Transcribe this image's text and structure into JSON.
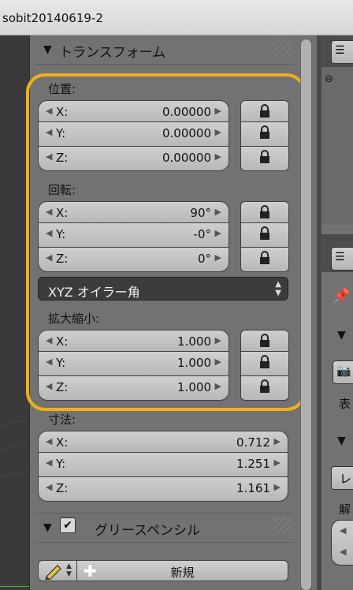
{
  "window": {
    "title": "sobit20140619-2"
  },
  "transform": {
    "header": "トランスフォーム",
    "location": {
      "label": "位置:",
      "rows": [
        {
          "axis": "X:",
          "value": "0.00000"
        },
        {
          "axis": "Y:",
          "value": "0.00000"
        },
        {
          "axis": "Z:",
          "value": "0.00000"
        }
      ]
    },
    "rotation": {
      "label": "回転:",
      "rows": [
        {
          "axis": "X:",
          "value": "90°"
        },
        {
          "axis": "Y:",
          "value": "-0°"
        },
        {
          "axis": "Z:",
          "value": "0°"
        }
      ]
    },
    "rotation_mode": "XYZ オイラー角",
    "scale": {
      "label": "拡大縮小:",
      "rows": [
        {
          "axis": "X:",
          "value": "1.000"
        },
        {
          "axis": "Y:",
          "value": "1.000"
        },
        {
          "axis": "Z:",
          "value": "1.000"
        }
      ]
    },
    "dimensions": {
      "label": "寸法:",
      "rows": [
        {
          "axis": "X:",
          "value": "0.712"
        },
        {
          "axis": "Y:",
          "value": "1.251"
        },
        {
          "axis": "Z:",
          "value": "1.161"
        }
      ]
    }
  },
  "grease_pencil": {
    "header": "グリースペンシル",
    "enabled": true,
    "new_label": "新規"
  },
  "right_panel": {
    "label_display": "表",
    "button_le": "レ",
    "label_resolution": "解"
  },
  "colors": {
    "highlight": "#f0b01e",
    "panel_bg": "#727272",
    "field_bg": "#c4c4c4"
  },
  "icons": [
    "lock-icon",
    "disclosure-triangle-icon",
    "pencil-icon",
    "plus-icon",
    "checkbox-icon",
    "pin-icon",
    "camera-icon"
  ]
}
